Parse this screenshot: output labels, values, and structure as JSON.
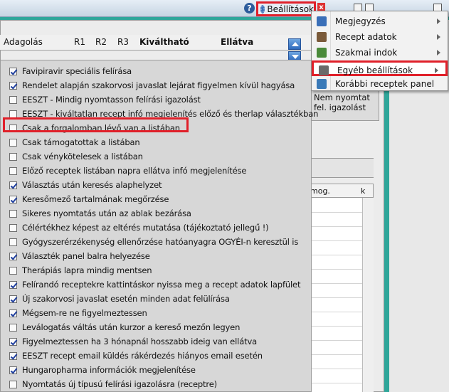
{
  "toolbar": {
    "help_icon": "?",
    "settings_label": "Beállítások",
    "close_icon": "x"
  },
  "columns": {
    "adagolas": "Adagolás",
    "r1": "R1",
    "r2": "R2",
    "r3": "R3",
    "kivalthato": "Kiváltható",
    "ellatva": "Ellátva"
  },
  "print_button": {
    "label_line1": "Nem nyomtat",
    "label_line2": "fel. igazolást"
  },
  "grid": {
    "col_mog": "mog.",
    "col_k": "k"
  },
  "menu": {
    "items": [
      {
        "label": "Megjegyzés",
        "icon": "note-icon",
        "submenu": true
      },
      {
        "label": "Recept adatok",
        "icon": "recipe-icon",
        "submenu": true
      },
      {
        "label": "Szakmai indok",
        "icon": "medical-icon",
        "submenu": true
      },
      {
        "label": "Egyéb beállítások",
        "icon": "tools-icon",
        "submenu": true,
        "selected": true
      },
      {
        "label": "Korábbi receptek panel",
        "icon": "panel-icon",
        "submenu": false
      }
    ]
  },
  "options": [
    {
      "label": "Favipiravir speciális felírása",
      "checked": true
    },
    {
      "label": "Rendelet alapján szakorvosi javaslat lejárat figyelmen kívül hagyása",
      "checked": true
    },
    {
      "label": "EESZT - Mindig nyomtasson felírási igazolást",
      "checked": false
    },
    {
      "label": "EESZT - kiváltatlan recept infó megjelenítés előző és therlap választékban",
      "checked": false
    },
    {
      "label": "Csak a forgalomban lévő van a listában",
      "checked": false
    },
    {
      "label": "Csak támogatottak a listában",
      "checked": false
    },
    {
      "label": "Csak vénykötelesek a listában",
      "checked": false
    },
    {
      "label": "Előző receptek listában napra ellátva infó megjelenítése",
      "checked": false
    },
    {
      "label": "Választás után keresés alaphelyzet",
      "checked": true
    },
    {
      "label": "Keresőmező tartalmának megőrzése",
      "checked": true
    },
    {
      "label": "Sikeres nyomtatás után az ablak bezárása",
      "checked": false
    },
    {
      "label": "Célértékhez képest az eltérés mutatása (tájékoztató jellegű !)",
      "checked": false
    },
    {
      "label": "Gyógyszerérzékenység ellenőrzése hatóanyagra OGYÉI-n keresztül is",
      "checked": false
    },
    {
      "label": "Választék panel balra helyezése",
      "checked": true
    },
    {
      "label": "Therápiás lapra mindig mentsen",
      "checked": false
    },
    {
      "label": "Felírandó receptekre kattintáskor nyissa meg a recept adatok lapfület",
      "checked": true
    },
    {
      "label": "Új szakorvosi javaslat esetén minden adat felülírása",
      "checked": true
    },
    {
      "label": "Mégsem-re ne figyelmeztessen",
      "checked": true
    },
    {
      "label": "Leválogatás váltás után kurzor a kereső mezőn legyen",
      "checked": false
    },
    {
      "label": "Figyelmeztessen ha 3 hónapnál hosszabb ideig van ellátva",
      "checked": true
    },
    {
      "label": "EESZT recept email küldés rákérdezés hiányos email esetén",
      "checked": true
    },
    {
      "label": "Hungaropharma információk megjelenítése",
      "checked": true
    },
    {
      "label": "Nyomtatás új típusú felírási igazolásra (receptre)",
      "checked": false
    }
  ]
}
